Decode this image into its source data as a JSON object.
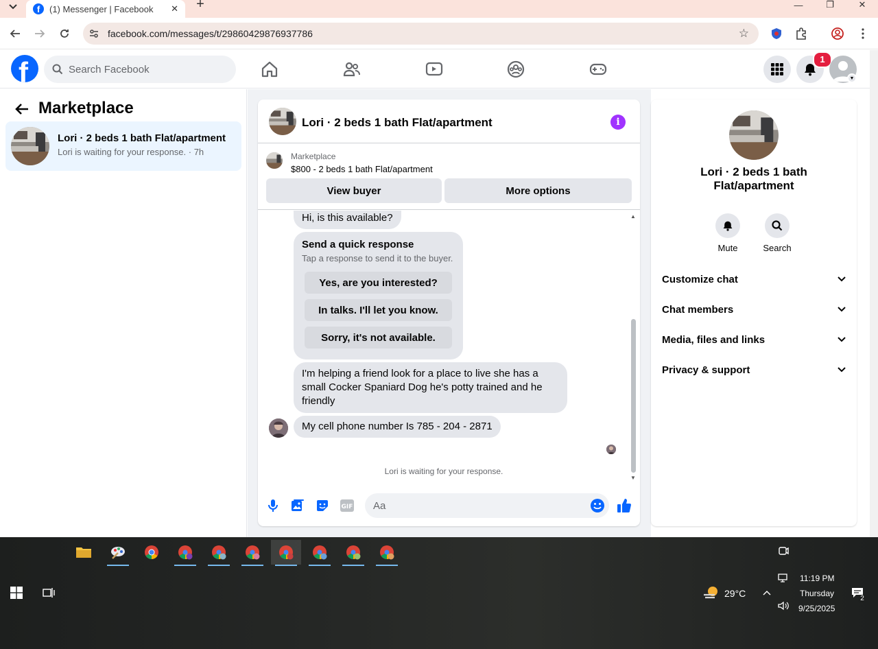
{
  "browser": {
    "tab_title": "(1) Messenger | Facebook",
    "url": "facebook.com/messages/t/29860429876937786"
  },
  "fb_header": {
    "search_placeholder": "Search Facebook",
    "notification_count": "1"
  },
  "left_panel": {
    "title": "Marketplace",
    "conversations": [
      {
        "name": "Lori · 2 beds 1 bath Flat/apartment",
        "preview": "Lori is waiting for your response. · 7h"
      }
    ]
  },
  "chat": {
    "title": "Lori · 2 beds 1 bath Flat/apartment",
    "listing": {
      "label": "Marketplace",
      "price_title": "$800 - 2 beds 1 bath Flat/apartment",
      "view_buyer": "View buyer",
      "more_options": "More options"
    },
    "messages": [
      "Hi, is this available?",
      "I'm helping a friend  look for a place to live she has a small Cocker Spaniard Dog he's potty trained and he friendly",
      "My cell phone number Is 785 - 204 - 2871"
    ],
    "quick_response": {
      "title": "Send a quick response",
      "subtitle": "Tap a response to send it to the buyer.",
      "options": [
        "Yes, are you interested?",
        "In talks. I'll let you know.",
        "Sorry, it's not available."
      ]
    },
    "waiting_note": "Lori is waiting for your response.",
    "composer_placeholder": "Aa"
  },
  "right_panel": {
    "title": "Lori · 2 beds 1 bath Flat/apartment",
    "actions": [
      "Mute",
      "Search"
    ],
    "sections": [
      "Customize chat",
      "Chat members",
      "Media, files and links",
      "Privacy & support"
    ]
  },
  "taskbar": {
    "weather": "29°C",
    "time": "11:19 PM",
    "day": "Thursday",
    "date": "9/25/2025",
    "notification_count": "2"
  },
  "colors": {
    "fb_blue": "#0866ff",
    "selected_bg": "#ebf5ff",
    "info_purple": "#a033ff",
    "badge_red": "#e41e3f"
  }
}
